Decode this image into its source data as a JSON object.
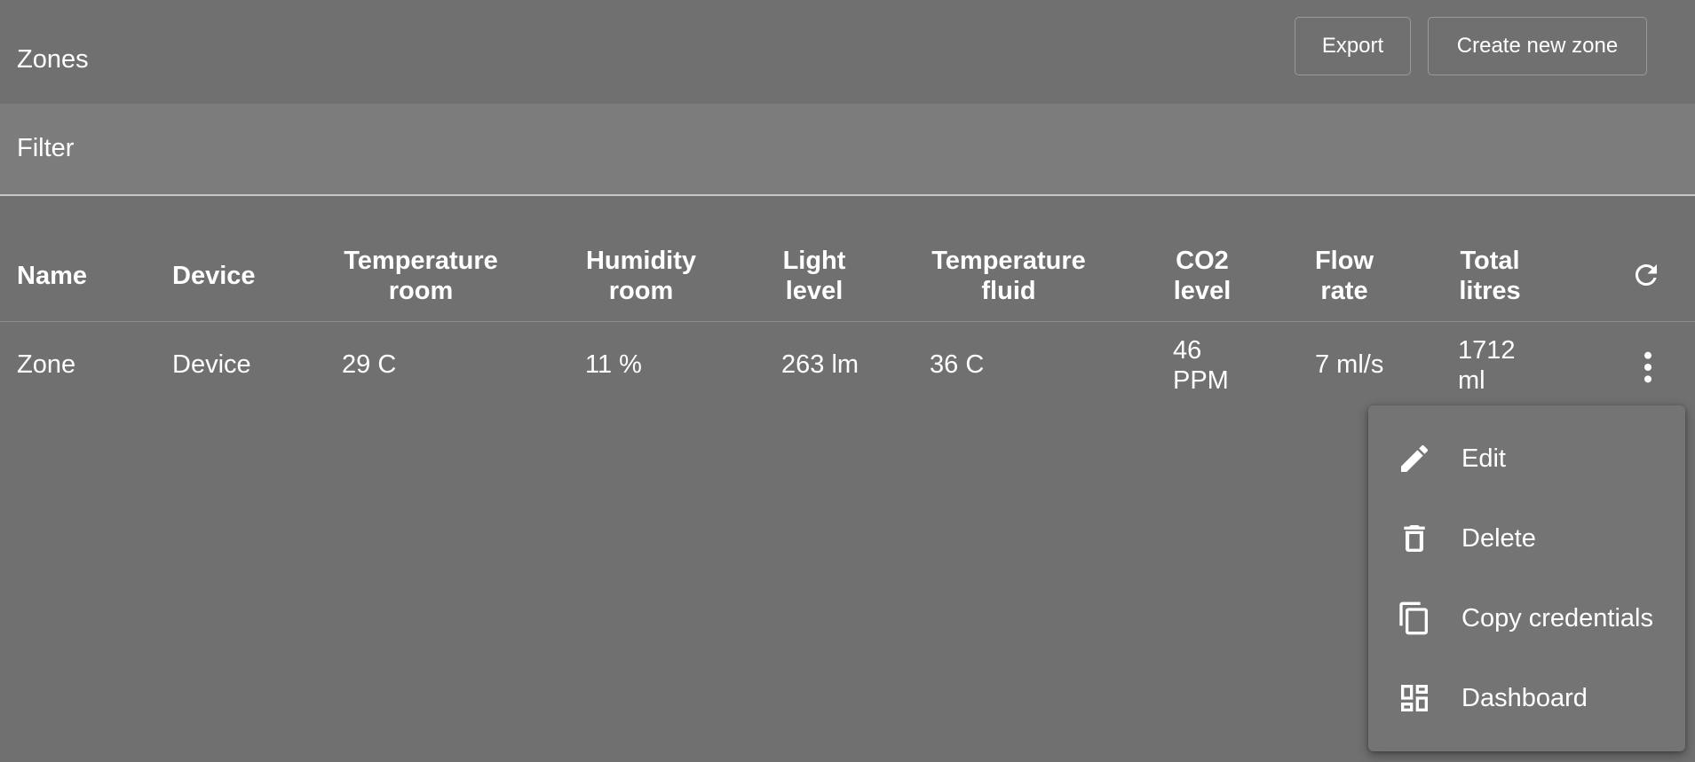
{
  "header": {
    "title": "Zones",
    "export_label": "Export",
    "create_label": "Create new zone"
  },
  "filter": {
    "label": "Filter"
  },
  "table": {
    "columns": [
      {
        "line1": "Name",
        "line2": ""
      },
      {
        "line1": "Device",
        "line2": ""
      },
      {
        "line1": "Temperature",
        "line2": "room"
      },
      {
        "line1": "Humidity",
        "line2": "room"
      },
      {
        "line1": "Light",
        "line2": "level"
      },
      {
        "line1": "Temperature",
        "line2": "fluid"
      },
      {
        "line1": "CO2",
        "line2": "level"
      },
      {
        "line1": "Flow",
        "line2": "rate"
      },
      {
        "line1": "Total",
        "line2": "litres"
      }
    ],
    "rows": [
      {
        "name": "Zone",
        "device": "Device",
        "temperature_room": "29 C",
        "humidity_room": "11 %",
        "light_level": "263 lm",
        "temperature_fluid": "36 C",
        "co2_level_line1": "46",
        "co2_level_line2": "PPM",
        "flow_rate": "7 ml/s",
        "total_litres_line1": "1712",
        "total_litres_line2": "ml"
      }
    ],
    "refresh_icon": "refresh-icon",
    "row_menu_icon": "more-vertical-icon"
  },
  "row_menu": {
    "items": [
      {
        "label": "Edit",
        "icon": "pencil-icon"
      },
      {
        "label": "Delete",
        "icon": "trash-icon"
      },
      {
        "label": "Copy credentials",
        "icon": "copy-icon"
      },
      {
        "label": "Dashboard",
        "icon": "dashboard-icon"
      }
    ]
  },
  "colors": {
    "background": "#707070",
    "filter_bar": "#7c7c7c",
    "menu_background": "#747474",
    "text": "#ffffff"
  }
}
